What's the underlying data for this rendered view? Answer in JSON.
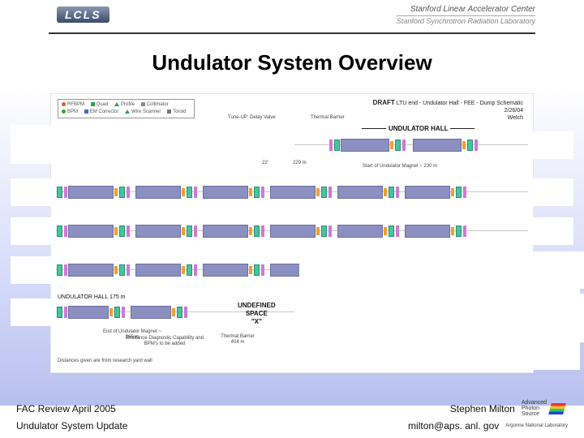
{
  "header": {
    "logo_text": "LCLS",
    "right_line1": "Stanford Linear Accelerator Center",
    "right_line2": "Stanford Synchrotron Radiation Laboratory"
  },
  "title": "Undulator System Overview",
  "legend": {
    "items": [
      {
        "label": "RFBPM",
        "color": "#e05a2a",
        "shape": "dot"
      },
      {
        "label": "Quad",
        "color": "#2aa54a",
        "shape": "sq"
      },
      {
        "label": "Profile",
        "color": "#3a6",
        "shape": "tri"
      },
      {
        "label": "Collimator",
        "color": "#888",
        "shape": "sq"
      },
      {
        "label": "BPM",
        "color": "#3aa02a",
        "shape": "dot"
      },
      {
        "label": "EM Corrector",
        "color": "#3b6fd4",
        "shape": "sq"
      },
      {
        "label": "Wire Scanner",
        "color": "#1a6",
        "shape": "tri"
      },
      {
        "label": "Toroid",
        "color": "#777",
        "shape": "sq"
      }
    ],
    "tune_up": "Tune-UP: Delay Valve",
    "thermal_barrier": "Thermal Barrier"
  },
  "draft": {
    "label": "DRAFT",
    "desc": "LTU end - Undulator Hall - FEE - Dump Schematic",
    "date": "2/26/04",
    "author": "Welch"
  },
  "labels": {
    "undulator_hall": "UNDULATOR HALL",
    "undulator_hall_len": "UNDULATOR HALL 175 m",
    "start_magnet": "Start of Undulator Magnet ~ 230 m",
    "dim_a": "22'",
    "dim_b": "229 m",
    "end_magnet": "End of Undulator Magnet ~ 365 m",
    "thermal_barrier_404": "Thermal Barrier 404 m",
    "emittance": "Emittance Diagnostic Capability and BPM's to be added",
    "distances_note": "Distances given are from research yard wall",
    "undefined_space1": "UNDEFINED",
    "undefined_space2": "SPACE",
    "undefined_space_x": "\"X\""
  },
  "footer": {
    "left1": "FAC Review April 2005",
    "right1": "Stephen Milton",
    "left2": "Undulator System Update",
    "right2": "milton@aps. anl. gov",
    "aps1": "Advanced",
    "aps2": "Photon",
    "aps3": "Source",
    "argonne1": "Argonne National Laboratory"
  }
}
